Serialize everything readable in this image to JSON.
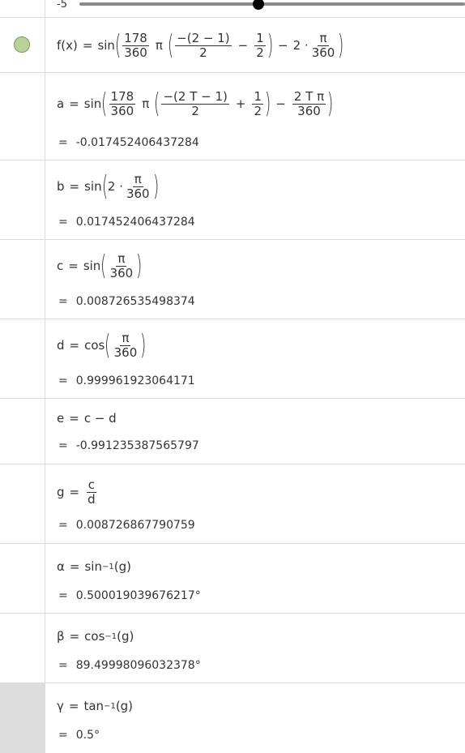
{
  "slider": {
    "value": "-5"
  },
  "f": {
    "name": "f(x)",
    "fn": "sin",
    "n178": "178",
    "n360": "360",
    "pi": "π",
    "inner": "−(2 − 1)",
    "two": "2",
    "one": "1",
    "minus": "−",
    "times": "2 ·"
  },
  "a": {
    "name": "a",
    "fn": "sin",
    "n178": "178",
    "n360": "360",
    "pi": "π",
    "inner": "−(2 T − 1)",
    "two": "2",
    "one": "1",
    "plus": "+",
    "twoTpi": "2 T π",
    "value": "-0.017452406437284"
  },
  "b": {
    "name": "b",
    "fn": "sin",
    "times": "2 ·",
    "pi": "π",
    "n360": "360",
    "value": "0.017452406437284"
  },
  "c": {
    "name": "c",
    "fn": "sin",
    "pi": "π",
    "n360": "360",
    "value": "0.008726535498374"
  },
  "d": {
    "name": "d",
    "fn": "cos",
    "pi": "π",
    "n360": "360",
    "value": "0.999961923064171"
  },
  "e": {
    "name": "e",
    "expr": "c − d",
    "value": "-0.991235387565797"
  },
  "g": {
    "name": "g",
    "num": "c",
    "den": "d",
    "value": "0.008726867790759"
  },
  "alpha": {
    "name": "α",
    "fn": "sin",
    "sup": "−1",
    "arg": "(g)",
    "value": "0.500019039676217°"
  },
  "beta": {
    "name": "β",
    "fn": "cos",
    "sup": "−1",
    "arg": "(g)",
    "value": "89.49998096032378°"
  },
  "gamma": {
    "name": "γ",
    "fn": "tan",
    "sup": "−1",
    "arg": "(g)",
    "value": "0.5°"
  },
  "eq": "="
}
